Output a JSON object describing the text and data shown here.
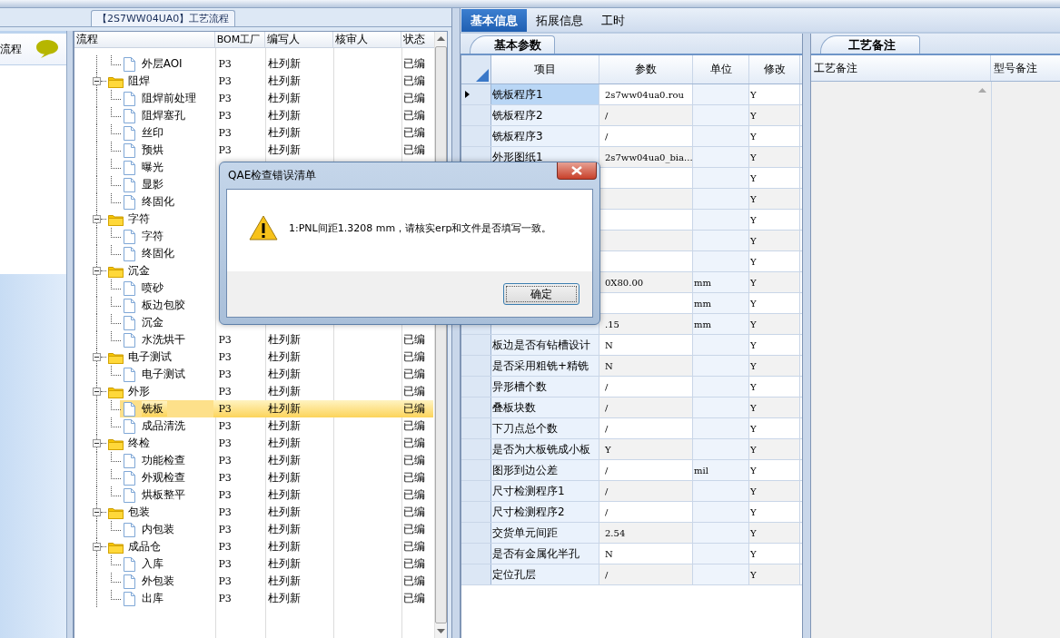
{
  "left_panel": {
    "label": "流程"
  },
  "flow_tab": {
    "title": "【2S7WW04UA0】工艺流程"
  },
  "tree": {
    "columns": [
      "流程",
      "BOM工厂",
      "编写人",
      "核审人",
      "状态"
    ],
    "nodes": [
      {
        "children": [
          {
            "name": "外层AOI",
            "bom": "P3",
            "author": "杜列新",
            "status": "已编",
            "selected": false
          }
        ]
      },
      {
        "name": "阻焊",
        "bom": "P3",
        "author": "杜列新",
        "status": "已编",
        "expanded": true,
        "selected": false,
        "children": [
          {
            "name": "阻焊前处理",
            "bom": "P3",
            "author": "杜列新",
            "status": "已编",
            "selected": false
          },
          {
            "name": "阻焊塞孔",
            "bom": "P3",
            "author": "杜列新",
            "status": "已编",
            "selected": false
          },
          {
            "name": "丝印",
            "bom": "P3",
            "author": "杜列新",
            "status": "已编",
            "selected": false
          },
          {
            "name": "预烘",
            "bom": "P3",
            "author": "杜列新",
            "status": "已编",
            "selected": false
          },
          {
            "name": "曝光",
            "selected": false
          },
          {
            "name": "显影",
            "selected": false
          },
          {
            "name": "终固化",
            "selected": false
          }
        ]
      },
      {
        "name": "字符",
        "expanded": true,
        "selected": false,
        "children": [
          {
            "name": "字符",
            "selected": false
          },
          {
            "name": "终固化",
            "selected": false
          }
        ]
      },
      {
        "name": "沉金",
        "expanded": true,
        "selected": false,
        "children": [
          {
            "name": "喷砂",
            "selected": false
          },
          {
            "name": "板边包胶",
            "selected": false
          },
          {
            "name": "沉金",
            "selected": false
          },
          {
            "name": "水洗烘干",
            "bom": "P3",
            "author": "杜列新",
            "status": "已编",
            "selected": false
          }
        ]
      },
      {
        "name": "电子测试",
        "bom": "P3",
        "author": "杜列新",
        "status": "已编",
        "expanded": true,
        "selected": false,
        "children": [
          {
            "name": "电子测试",
            "bom": "P3",
            "author": "杜列新",
            "status": "已编",
            "selected": false
          }
        ]
      },
      {
        "name": "外形",
        "bom": "P3",
        "author": "杜列新",
        "status": "已编",
        "expanded": true,
        "selected": false,
        "children": [
          {
            "name": "铣板",
            "bom": "P3",
            "author": "杜列新",
            "status": "已编",
            "selected": true
          },
          {
            "name": "成品清洗",
            "bom": "P3",
            "author": "杜列新",
            "status": "已编",
            "selected": false
          }
        ]
      },
      {
        "name": "终检",
        "bom": "P3",
        "author": "杜列新",
        "status": "已编",
        "expanded": true,
        "selected": false,
        "children": [
          {
            "name": "功能检查",
            "bom": "P3",
            "author": "杜列新",
            "status": "已编",
            "selected": false
          },
          {
            "name": "外观检查",
            "bom": "P3",
            "author": "杜列新",
            "status": "已编",
            "selected": false
          },
          {
            "name": "烘板整平",
            "bom": "P3",
            "author": "杜列新",
            "status": "已编",
            "selected": false
          }
        ]
      },
      {
        "name": "包装",
        "bom": "P3",
        "author": "杜列新",
        "status": "已编",
        "expanded": true,
        "selected": false,
        "children": [
          {
            "name": "内包装",
            "bom": "P3",
            "author": "杜列新",
            "status": "已编",
            "selected": false
          }
        ]
      },
      {
        "name": "成品仓",
        "bom": "P3",
        "author": "杜列新",
        "status": "已编",
        "expanded": true,
        "selected": false,
        "children": [
          {
            "name": "入库",
            "bom": "P3",
            "author": "杜列新",
            "status": "已编",
            "selected": false
          },
          {
            "name": "外包装",
            "bom": "P3",
            "author": "杜列新",
            "status": "已编",
            "selected": false
          },
          {
            "name": "出库",
            "bom": "P3",
            "author": "杜列新",
            "status": "已编",
            "selected": false
          }
        ]
      }
    ]
  },
  "tabs": [
    {
      "label": "基本信息",
      "selected": true
    },
    {
      "label": "拓展信息",
      "selected": false
    },
    {
      "label": "工时",
      "selected": false
    }
  ],
  "sub_tab": {
    "label": "基本参数"
  },
  "params": {
    "columns": [
      "项目",
      "参数",
      "单位",
      "修改"
    ],
    "rows": [
      {
        "item": "铣板程序1",
        "value": "2s7ww04ua0.rou",
        "modify": "Y",
        "selected": true
      },
      {
        "item": "铣板程序2",
        "value": "/",
        "modify": "Y",
        "selected": false
      },
      {
        "item": "铣板程序3",
        "value": "/",
        "modify": "Y",
        "selected": false
      },
      {
        "item": "外形图纸1",
        "value": "2s7ww04ua0_bia...",
        "modify": "Y",
        "selected": false
      },
      {
        "modify": "Y"
      },
      {
        "modify": "Y"
      },
      {
        "modify": "Y"
      },
      {
        "modify": "Y"
      },
      {
        "modify": "Y"
      },
      {
        "value": "0X80.00",
        "unit": "mm",
        "modify": "Y"
      },
      {
        "unit": "mm",
        "modify": "Y"
      },
      {
        "value": ".15",
        "unit": "mm",
        "modify": "Y",
        "selected": false
      },
      {
        "item": "板边是否有钻槽设计",
        "value": "N",
        "modify": "Y",
        "selected": false
      },
      {
        "item": "是否采用粗铣+精铣",
        "value": "N",
        "modify": "Y",
        "selected": false
      },
      {
        "item": "异形槽个数",
        "value": "/",
        "modify": "Y",
        "selected": false
      },
      {
        "item": "叠板块数",
        "value": "/",
        "modify": "Y",
        "selected": false
      },
      {
        "item": "下刀点总个数",
        "value": "/",
        "modify": "Y",
        "selected": false
      },
      {
        "item": "是否为大板铣成小板",
        "value": "Y",
        "modify": "Y",
        "selected": false
      },
      {
        "item": "图形到边公差",
        "value": "/",
        "unit": "mil",
        "modify": "Y",
        "selected": false
      },
      {
        "item": "尺寸检测程序1",
        "value": "/",
        "modify": "Y",
        "selected": false
      },
      {
        "item": "尺寸检测程序2",
        "value": "/",
        "modify": "Y",
        "selected": false
      },
      {
        "item": "交货单元间距",
        "value": "2.54",
        "modify": "Y",
        "selected": false
      },
      {
        "item": "是否有金属化半孔",
        "value": "N",
        "modify": "Y",
        "selected": false
      },
      {
        "item": "定位孔层",
        "value": "/",
        "modify": "Y",
        "selected": false
      }
    ]
  },
  "notes_tab": {
    "label": "工艺备注"
  },
  "notes": {
    "columns": [
      "工艺备注",
      "型号备注"
    ]
  },
  "dialog": {
    "title": "QAE检查错误清单",
    "message": "1:PNL间距1.3208 mm，请核实erp和文件是否填写一致。",
    "button": "确定"
  }
}
